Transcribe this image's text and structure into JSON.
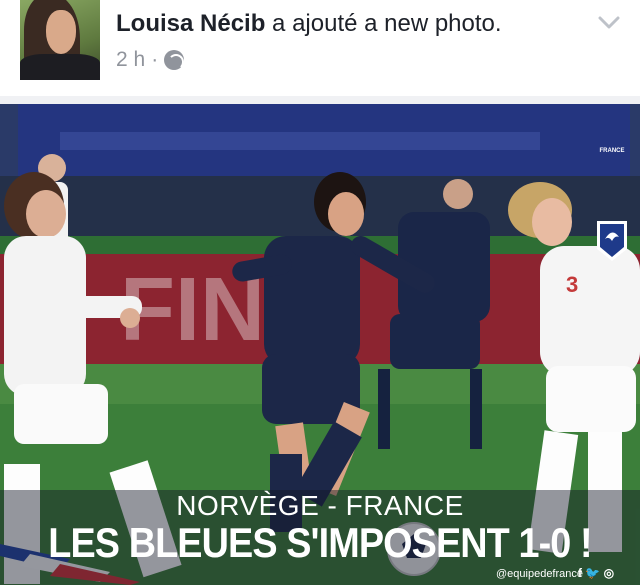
{
  "post": {
    "author": "Louisa Nécib",
    "action": "a ajouté a new photo.",
    "time": "2 h",
    "separator": "·",
    "audience_icon": "globe-icon",
    "menu_icon": "chevron-down-icon"
  },
  "photo": {
    "caption_line1": "NORVÈGE - FRANCE",
    "caption_line2": "LES BLEUES S'IMPOSENT 1-0 !",
    "credit": "@equipedefrance",
    "social_icons": "f 🐦 ◎",
    "badge_text": "FRANCE",
    "colors": {
      "pitch": "#2e6e34",
      "france_kit": "#1c2748",
      "norway_kit": "#ffffff",
      "banner": "#1e2a64"
    }
  }
}
